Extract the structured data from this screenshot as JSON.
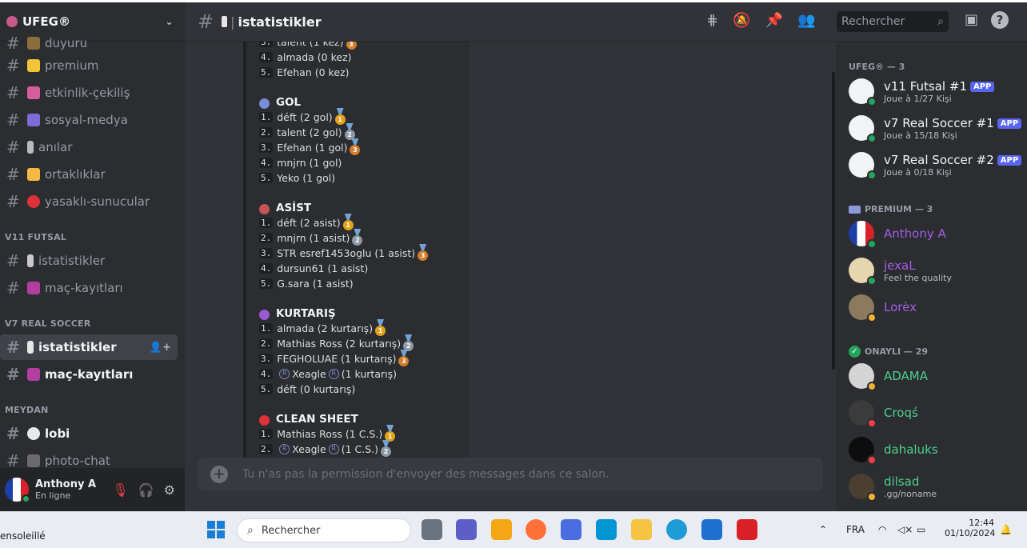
{
  "server": {
    "name": "UFEG®"
  },
  "sidebar": {
    "channels": [
      {
        "label": "duyuru"
      },
      {
        "label": "premium"
      },
      {
        "label": "etkinlik-çekiliş"
      },
      {
        "label": "sosyal-medya"
      },
      {
        "label": "anılar"
      },
      {
        "label": "ortaklıklar"
      },
      {
        "label": "yasaklı-sunucular"
      }
    ],
    "cat_futsal": "V11 FUTSAL",
    "futsal": [
      {
        "label": "istatistikler"
      },
      {
        "label": "maç-kayıtları"
      }
    ],
    "cat_real": "V7 REAL SOCCER",
    "real": [
      {
        "label": "istatistikler"
      },
      {
        "label": "maç-kayıtları"
      }
    ],
    "cat_meydan": "MEYDAN",
    "meydan": [
      {
        "label": "lobi"
      },
      {
        "label": "photo-chat"
      }
    ]
  },
  "user": {
    "name": "Anthony A",
    "status": "En ligne"
  },
  "header": {
    "title": "istatistikler",
    "search_placeholder": "Rechercher"
  },
  "embed": {
    "top_lines": [
      {
        "n": "3.",
        "t": "talent (1 kez)",
        "medal": "3"
      },
      {
        "n": "4.",
        "t": "almada (0 kez)"
      },
      {
        "n": "5.",
        "t": "Efehan (0 kez)"
      }
    ],
    "sections": [
      {
        "title": "GOL",
        "rows": [
          {
            "n": "1.",
            "t": "déft (2 gol)"
          },
          {
            "n": "2.",
            "t": "talent (2 gol)"
          },
          {
            "n": "3.",
            "t": "Efehan (1 gol)"
          },
          {
            "n": "4.",
            "t": "mnjrn (1 gol)"
          },
          {
            "n": "5.",
            "t": "Yeko (1 gol)"
          }
        ]
      },
      {
        "title": "ASİST",
        "rows": [
          {
            "n": "1.",
            "t": "déft (2 asist)"
          },
          {
            "n": "2.",
            "t": "mnjrn (1 asist)"
          },
          {
            "n": "3.",
            "t": "STR esref1453oglu (1 asist)"
          },
          {
            "n": "4.",
            "t": "dursun61 (1 asist)"
          },
          {
            "n": "5.",
            "t": "G.sara (1 asist)"
          }
        ]
      },
      {
        "title": "KURTARIŞ",
        "rows": [
          {
            "n": "1.",
            "t": "almada (2 kurtarış)"
          },
          {
            "n": "2.",
            "t": "Mathias Ross (2 kurtarış)"
          },
          {
            "n": "3.",
            "t": "FEGHOLUAE (1 kurtarış)"
          },
          {
            "n": "4.",
            "t": "Xeagle",
            "t2": "(1 kurtarış)"
          },
          {
            "n": "5.",
            "t": "déft (0 kurtarış)"
          }
        ]
      },
      {
        "title": "CLEAN SHEET",
        "rows": [
          {
            "n": "1.",
            "t": "Mathias Ross (1 C.S.)"
          },
          {
            "n": "2.",
            "t": "Xeagle",
            "t2": "(1 C.S.)"
          }
        ]
      }
    ]
  },
  "composer": {
    "placeholder": "Tu n'as pas la permission d'envoyer des messages dans ce salon."
  },
  "members": {
    "cat1": "UFEG® — 3",
    "bots": [
      {
        "name": "v11 Futsal #1",
        "badge": "APP",
        "sub": "Joue à 1/27 Kişi"
      },
      {
        "name": "v7 Real Soccer #1",
        "badge": "APP",
        "sub": "Joue à 15/18 Kişi"
      },
      {
        "name": "v7 Real Soccer #2",
        "badge": "APP",
        "sub": "Joue à 0/18 Kişi"
      }
    ],
    "cat2": "PREMIUM — 3",
    "premium": [
      {
        "name": "Anthony A",
        "sub": ""
      },
      {
        "name": "jexaL",
        "sub": "Feel the quality"
      },
      {
        "name": "Lorèx",
        "sub": ""
      }
    ],
    "cat3": "ONAYLI — 29",
    "onayli": [
      {
        "name": "ADAMA",
        "sub": ""
      },
      {
        "name": "Croqś",
        "sub": ""
      },
      {
        "name": "dahaluks",
        "sub": ""
      },
      {
        "name": "dilsad",
        "sub": ".gg/noname"
      }
    ]
  },
  "taskbar": {
    "weather": "ensoleillé",
    "search": "Rechercher",
    "lang": "FRA",
    "time": "12:44",
    "date": "01/10/2024"
  }
}
